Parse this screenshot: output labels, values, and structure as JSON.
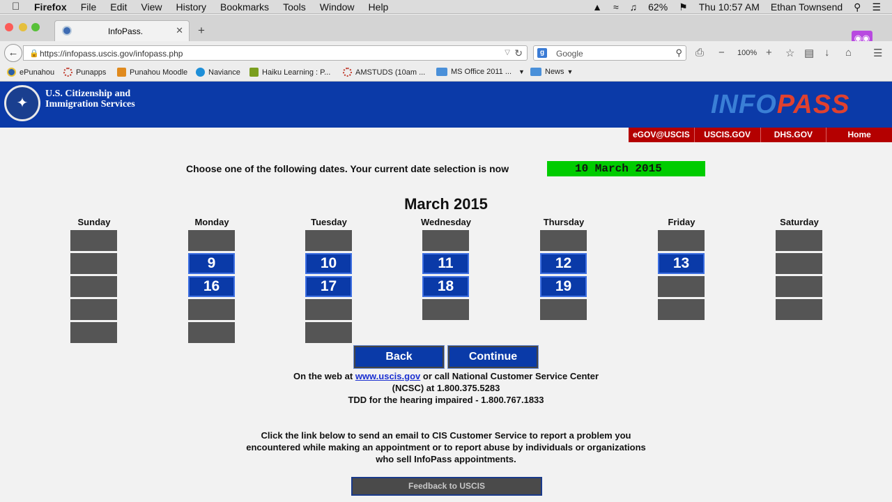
{
  "menubar": {
    "app": "Firefox",
    "items": [
      "File",
      "Edit",
      "View",
      "History",
      "Bookmarks",
      "Tools",
      "Window",
      "Help"
    ],
    "battery": "62%",
    "clock": "Thu 10:57 AM",
    "user": "Ethan Townsend"
  },
  "tab": {
    "title": "InfoPass."
  },
  "navbar": {
    "url": "https://infopass.uscis.gov/infopass.php",
    "search_placeholder": "Google",
    "zoom": "100%"
  },
  "bookmarks": [
    {
      "label": "ePunahou",
      "icon": "circle-icon",
      "color": "#2a5ea8"
    },
    {
      "label": "Punapps",
      "icon": "ring-icon",
      "color": "#c0392b"
    },
    {
      "label": "Punahou Moodle",
      "icon": "moodle-icon",
      "color": "#e08a1e"
    },
    {
      "label": "Naviance",
      "icon": "naviance-icon",
      "color": "#1e8fd8"
    },
    {
      "label": "Haiku Learning : P...",
      "icon": "haiku-icon",
      "color": "#7a9e1e"
    },
    {
      "label": "AMSTUDS (10am ...",
      "icon": "ring-icon",
      "color": "#c0392b"
    },
    {
      "label": "MS Office 2011 ...",
      "icon": "folder-icon",
      "color": "#4a90d9"
    },
    {
      "label": "News",
      "icon": "folder-icon",
      "color": "#4a90d9"
    }
  ],
  "site": {
    "agency": "U.S. Citizenship and Immigration Services",
    "logo_left": "INFO",
    "logo_right": "PASS",
    "nav": [
      "eGOV@USCIS",
      "USCIS.GOV",
      "DHS.GOV",
      "Home"
    ]
  },
  "calendar": {
    "prompt": "Choose one of the following dates. Your current date selection is now",
    "selected": "10 March 2015",
    "month": "March 2015",
    "days": [
      "Sunday",
      "Monday",
      "Tuesday",
      "Wednesday",
      "Thursday",
      "Friday",
      "Saturday"
    ],
    "rows": [
      [
        "",
        "",
        "",
        "",
        "",
        "",
        ""
      ],
      [
        "",
        "9",
        "10",
        "11",
        "12",
        "13",
        ""
      ],
      [
        "",
        "16",
        "17",
        "18",
        "19",
        "",
        ""
      ],
      [
        "",
        "",
        "",
        "",
        "",
        "",
        ""
      ],
      [
        "",
        "",
        "",
        null,
        null,
        null,
        null
      ]
    ],
    "back_label": "Back",
    "continue_label": "Continue"
  },
  "footer": {
    "web_prefix": "On the web at",
    "web_link": "www.uscis.gov",
    "web_suffix": "or call National Customer Service Center",
    "ncsc": "(NCSC) at 1.800.375.5283",
    "tdd": "TDD for the hearing impaired - 1.800.767.1833",
    "report_1": "Click the link below to send an email to CIS Customer Service to report a problem you",
    "report_2": "encountered while making an appointment or to report abuse by individuals or organizations",
    "report_3": "who sell InfoPass appointments.",
    "feedback_label": "Feedback to USCIS"
  }
}
